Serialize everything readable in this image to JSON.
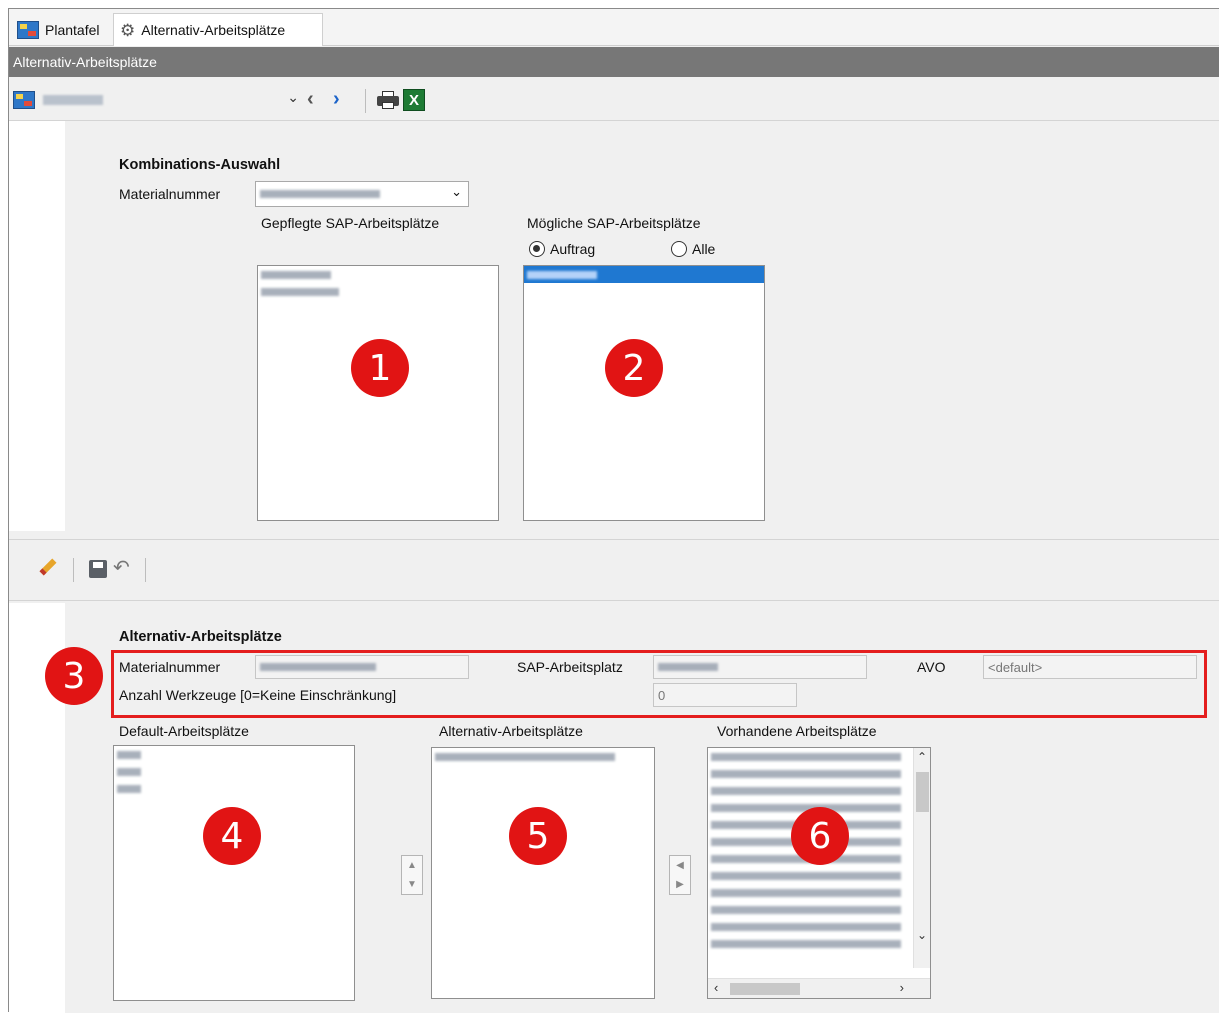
{
  "tabs": [
    {
      "label": "Plantafel",
      "icon": "planning-board-icon"
    },
    {
      "label": "Alternativ-Arbeitsplätze",
      "icon": "gear-icon"
    }
  ],
  "window_title": "Alternativ-Arbeitsplätze",
  "toolbar": {
    "view_selector_value": "Gaun",
    "icons": [
      "planning-board-icon",
      "chevron-down-icon",
      "previous-icon",
      "next-icon",
      "print-icon",
      "excel-export-icon"
    ]
  },
  "kombination": {
    "heading": "Kombinations-Auswahl",
    "material_label": "Materialnummer",
    "gepflegte_label": "Gepflegte SAP-Arbeitsplätze",
    "moegliche_label": "Mögliche SAP-Arbeitsplätze",
    "radio_auftrag": "Auftrag",
    "radio_alle": "Alle",
    "radio_selected": "Auftrag"
  },
  "edit_toolbar": {
    "icons": [
      "edit-pencil-icon",
      "save-icon",
      "undo-icon"
    ]
  },
  "alternativ": {
    "heading": "Alternativ-Arbeitsplätze",
    "material_label": "Materialnummer",
    "sap_label": "SAP-Arbeitsplatz",
    "avo_label": "AVO",
    "avo_value": "<default>",
    "anzahl_label": "Anzahl Werkzeuge [0=Keine Einschränkung]",
    "anzahl_value": "0",
    "default_label": "Default-Arbeitsplätze",
    "alternativ_label": "Alternativ-Arbeitsplätze",
    "vorhandene_label": "Vorhandene Arbeitsplätze"
  },
  "badges": [
    "1",
    "2",
    "3",
    "4",
    "5",
    "6"
  ],
  "colors": {
    "accent_red": "#e11414",
    "selection_blue": "#1f78d1",
    "titlebar_gray": "#777777"
  }
}
